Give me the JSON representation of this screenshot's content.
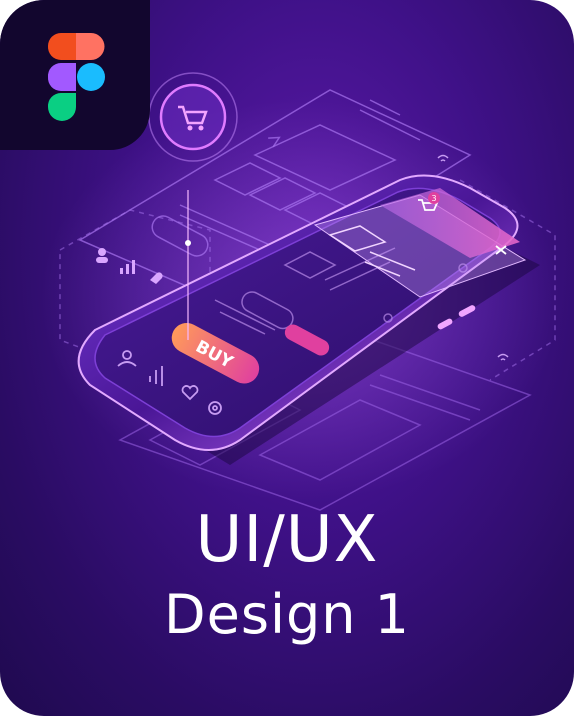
{
  "card": {
    "title": "UI/UX",
    "subtitle": "Design 1"
  },
  "illustration": {
    "buy_button_label": "BUY",
    "cart_badge": "3",
    "close_glyph": "×"
  },
  "colors": {
    "background": "#3f1188",
    "corner": "#12062e",
    "accent_pink": "#e94bb0",
    "accent_orange": "#ff8a5a",
    "line": "#b67cff"
  },
  "icons": [
    "figma-logo-icon",
    "cart-icon",
    "user-icon",
    "chart-icon",
    "heart-icon",
    "gear-icon",
    "close-icon"
  ]
}
